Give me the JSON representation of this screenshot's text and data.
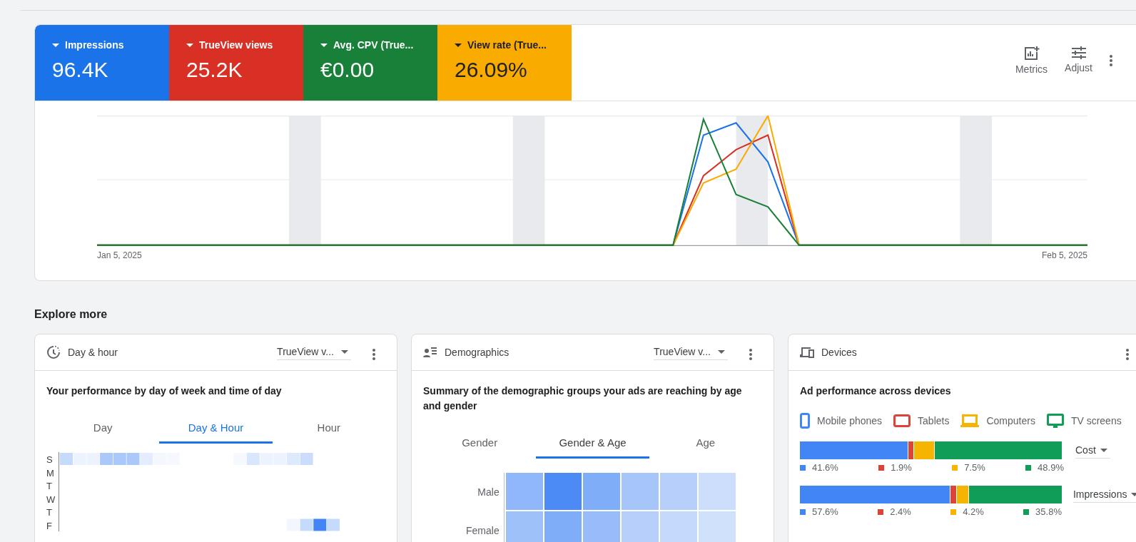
{
  "metric_tiles": [
    {
      "label": "Impressions",
      "value": "96.4K",
      "color": "#1a73e8"
    },
    {
      "label": "TrueView views",
      "value": "25.2K",
      "color": "#d93025"
    },
    {
      "label": "Avg. CPV (True...",
      "value": "€0.00",
      "color": "#188038"
    },
    {
      "label": "View rate (True...",
      "value": "26.09%",
      "color": "#f9ab00"
    }
  ],
  "toolbar": [
    {
      "label": "Metrics",
      "kind": "metrics"
    },
    {
      "label": "Adjust",
      "kind": "adjust"
    }
  ],
  "chart": {
    "x_start_label": "Jan 5, 2025",
    "x_end_label": "Feb 5, 2025"
  },
  "section_title": "Explore more",
  "cards": [
    {
      "kind": "dayhour",
      "title": "Day & hour",
      "dropdown": "TrueView v...",
      "subtitle": "Your performance by day of week and time of day",
      "tabs": [
        {
          "label": "Day",
          "selected": false
        },
        {
          "label": "Day & Hour",
          "selected": true
        },
        {
          "label": "Hour",
          "selected": false
        }
      ],
      "row_labels": [
        "S",
        "M",
        "T",
        "W",
        "T",
        "F"
      ]
    },
    {
      "kind": "demographics",
      "title": "Demographics",
      "dropdown": "TrueView v...",
      "subtitle": "Summary of the demographic groups your ads are reaching by age and gender",
      "tabs": [
        {
          "label": "Gender",
          "selected": false
        },
        {
          "label": "Gender & Age",
          "selected": true
        },
        {
          "label": "Age",
          "selected": false
        }
      ],
      "row_labels": [
        "Male",
        "Female"
      ]
    },
    {
      "kind": "devices",
      "title": "Devices",
      "subtitle": "Ad performance across devices",
      "legend": [
        {
          "label": "Mobile phones",
          "kind": "phone",
          "color": "#4285f4"
        },
        {
          "label": "Tablets",
          "kind": "tablet",
          "color": "#db4437"
        },
        {
          "label": "Computers",
          "kind": "computer",
          "color": "#f4b400"
        },
        {
          "label": "TV screens",
          "kind": "tv",
          "color": "#0f9d58"
        }
      ],
      "bars": [
        {
          "dropdown": "Cost",
          "segments": [
            {
              "value": "41.6%",
              "color": "#4285f4"
            },
            {
              "value": "1.9%",
              "color": "#db4437"
            },
            {
              "value": "7.5%",
              "color": "#f4b400"
            },
            {
              "value": "48.9%",
              "color": "#0f9d58"
            }
          ]
        },
        {
          "dropdown": "Impressions",
          "segments": [
            {
              "value": "57.6%",
              "color": "#4285f4"
            },
            {
              "value": "2.4%",
              "color": "#db4437"
            },
            {
              "value": "4.2%",
              "color": "#f4b400"
            },
            {
              "value": "35.8%",
              "color": "#0f9d58"
            }
          ]
        }
      ]
    }
  ]
}
